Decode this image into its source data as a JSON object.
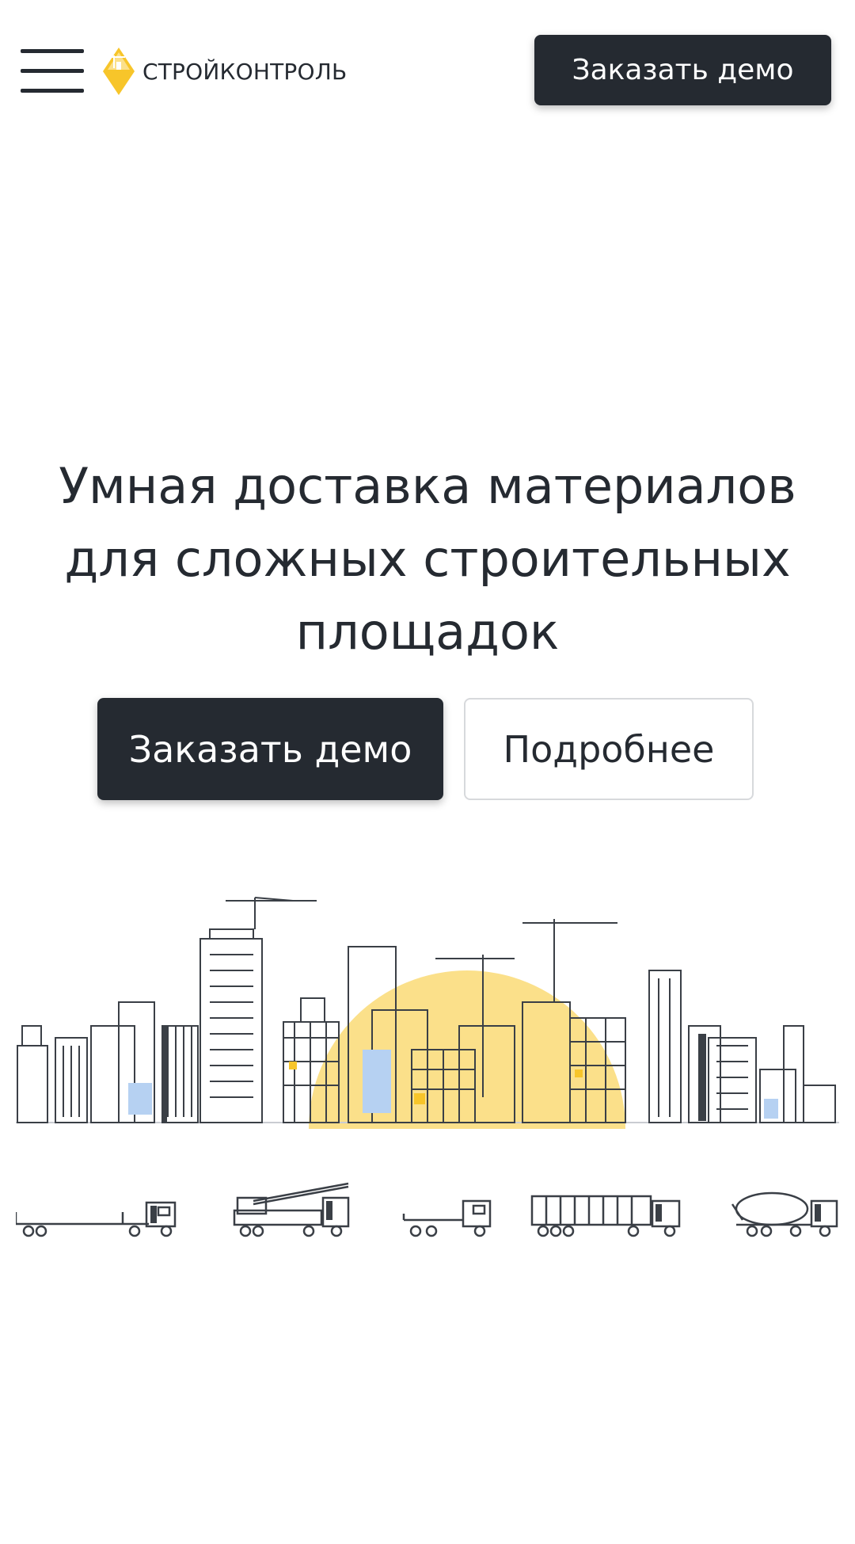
{
  "header": {
    "menu_icon": "hamburger-menu-icon",
    "logo_icon": "diamond-crane-logo-icon",
    "logo_text": "СТРОЙКОНТРОЛЬ",
    "cta_label": "Заказать демо"
  },
  "hero": {
    "title": "Умная доставка материалов для сложных строительных площадок",
    "primary_button": "Заказать демо",
    "secondary_button": "Подробнее"
  },
  "illustration": {
    "skyline": "city-construction-skyline-illustration",
    "vehicles": [
      "flatbed-truck-icon",
      "crane-truck-icon",
      "small-flatbed-truck-icon",
      "container-truck-icon",
      "concrete-mixer-truck-icon"
    ]
  },
  "colors": {
    "dark": "#252a31",
    "accent_yellow": "#f7c52a",
    "sun_yellow": "#fbe08a",
    "window_blue": "#b6d1f2"
  }
}
